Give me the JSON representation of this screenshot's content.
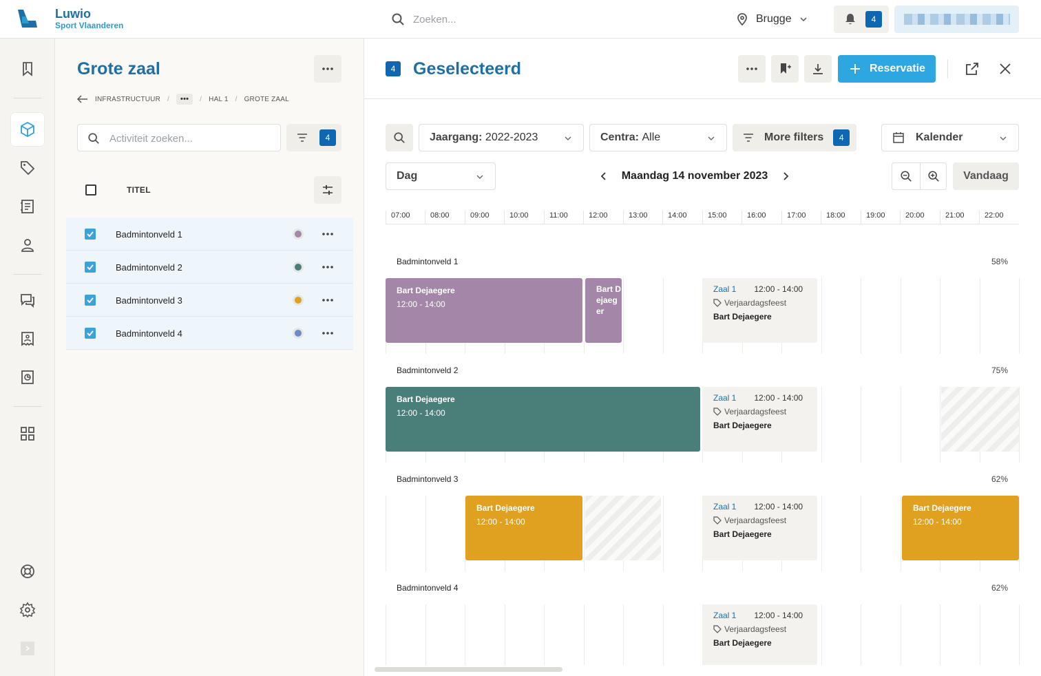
{
  "app": {
    "name": "Luwio",
    "subtitle": "Sport Vlaanderen"
  },
  "topbar": {
    "search_placeholder": "Zoeken...",
    "location": "Brugge",
    "notification_count": "4"
  },
  "colors": {
    "accent": "#1d6fa5",
    "primary_button": "#2ea7e0",
    "badge": "#0f67b1",
    "court1": "#a487a8",
    "court2": "#4a7f79",
    "court3": "#e0a020",
    "court4": "#6a8cc4"
  },
  "sidebar_icons": [
    "bookmark-icon",
    "cube-icon",
    "tag-icon",
    "ledger-icon",
    "user-icon",
    "chat-icon",
    "receipt-icon",
    "report-icon",
    "grid-icon",
    "lifebuoy-icon",
    "gear-icon",
    "chevron-right-icon"
  ],
  "left_panel": {
    "title": "Grote zaal",
    "breadcrumb": [
      "INFRASTRUCTUUR",
      "•••",
      "HAL 1",
      "GROTE ZAAL"
    ],
    "search_placeholder": "Activiteit zoeken...",
    "filter_count": "4",
    "column_title": "TITEL",
    "rows": [
      {
        "label": "Badmintonveld 1",
        "color": "#a487a8",
        "checked": true
      },
      {
        "label": "Badmintonveld 2",
        "color": "#4a7f79",
        "checked": true
      },
      {
        "label": "Badmintonveld 3",
        "color": "#e0a020",
        "checked": true
      },
      {
        "label": "Badmintonveld 4",
        "color": "#6a8cc4",
        "checked": true
      }
    ]
  },
  "right_panel": {
    "selected_count": "4",
    "title": "Geselecteerd",
    "reservation_button": "Reservatie",
    "filters": {
      "jaargang_label": "Jaargang:",
      "jaargang_value": "2022-2023",
      "centra_label": "Centra:",
      "centra_value": "Alle",
      "more_filters": "More filters",
      "more_filters_count": "4",
      "view_select": "Kalender",
      "range_select": "Dag",
      "date": "Maandag 14 november 2023",
      "today_button": "Vandaag"
    },
    "hours": [
      "07:00",
      "08:00",
      "09:00",
      "10:00",
      "11:00",
      "12:00",
      "13:00",
      "14:00",
      "15:00",
      "16:00",
      "17:00",
      "18:00",
      "19:00",
      "20:00",
      "21:00",
      "22:00"
    ],
    "lanes": [
      {
        "name": "Badmintonveld 1",
        "percent": "58%"
      },
      {
        "name": "Badmintonveld 2",
        "percent": "75%"
      },
      {
        "name": "Badmintonveld 3",
        "percent": "62%"
      },
      {
        "name": "Badmintonveld 4",
        "percent": "62%"
      }
    ],
    "booking": {
      "person": "Bart Dejaegere",
      "time": "12:00 - 14:00",
      "narrow_text": "Bart Dejaeger"
    },
    "info_card": {
      "room": "Zaal 1",
      "time": "12:00 - 14:00",
      "tag": "Verjaardagsfeest",
      "person": "Bart Dejaegere"
    }
  }
}
